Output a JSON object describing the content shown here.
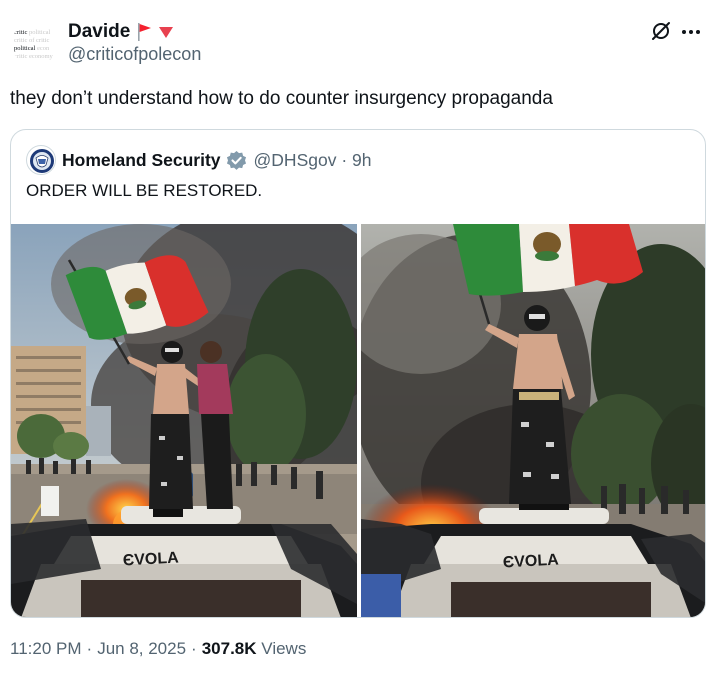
{
  "author": {
    "display_name": "Davide",
    "handle": "@criticofpolecon",
    "avatar_lines": [
      {
        "dark": "critic ",
        "light": "political"
      },
      {
        "dark": "",
        "light": "critic of critic"
      },
      {
        "dark": "political ",
        "light": "econ"
      },
      {
        "dark": "",
        "light": "critic economy"
      }
    ],
    "avatar_mid": "of"
  },
  "tweet": {
    "text": "they don’t understand how to do counter insurgency propaganda"
  },
  "quote": {
    "display_name": "Homeland Security",
    "handle": "@DHSgov",
    "separator": "·",
    "time": "9h",
    "text": "ORDER WILL BE RESTORED.",
    "graffiti_text": "ЄVOLA",
    "photos": [
      {
        "alt": "Shirtless masked man waving a Mexican flag atop a burning car, with another person beside him"
      },
      {
        "alt": "Shirtless masked man waving a Mexican flag atop a burning car amid smoke"
      }
    ]
  },
  "meta": {
    "time": "11:20 PM",
    "sep1": "·",
    "date": "Jun 8, 2025",
    "sep2": "·",
    "views_count": "307.8K",
    "views_label": "Views"
  },
  "colors": {
    "text": "#0f1419",
    "secondary": "#536471",
    "border": "#cfd9de",
    "verified_gray": "#829aab",
    "flag_red": "#f4212e",
    "mexico_green": "#2e8b3a",
    "mexico_red": "#d9302c"
  },
  "icons": {
    "flag": "red-flag-icon",
    "triangle": "red-triangle-icon",
    "grok": "grok-icon",
    "more": "more-icon",
    "verified": "verified-badge-icon",
    "seal": "dhs-seal-icon"
  }
}
